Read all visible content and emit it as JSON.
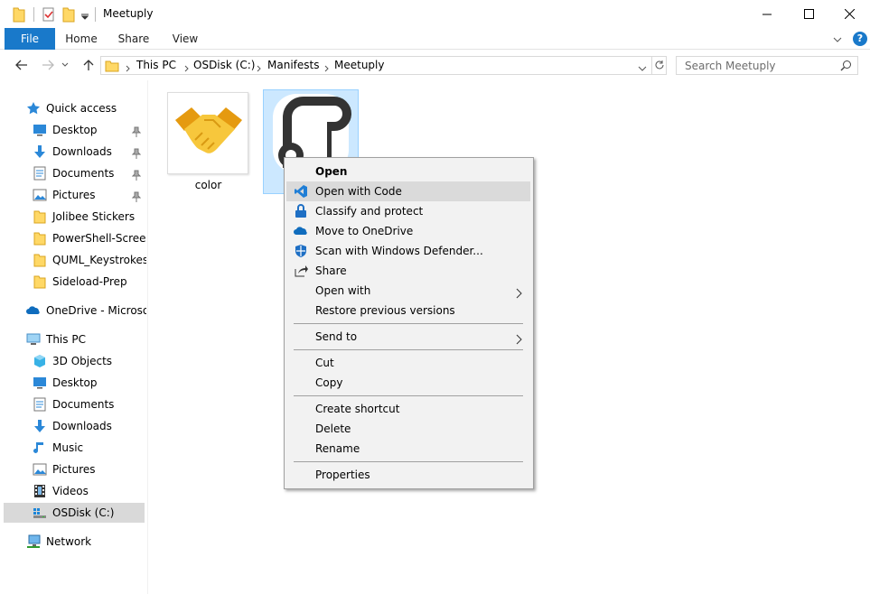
{
  "window": {
    "title": "Meetuply",
    "controls": [
      "minimize",
      "maximize",
      "close"
    ]
  },
  "ribbon": {
    "tabs": [
      {
        "label": "File",
        "active": true
      },
      {
        "label": "Home"
      },
      {
        "label": "Share"
      },
      {
        "label": "View"
      }
    ]
  },
  "address": {
    "crumbs": [
      "This PC",
      "OSDisk (C:)",
      "Manifests",
      "Meetuply"
    ]
  },
  "search": {
    "placeholder": "Search Meetuply"
  },
  "sidebar": {
    "quick_access": {
      "label": "Quick access",
      "items": [
        {
          "label": "Desktop",
          "icon": "desktop-icon",
          "pinned": true
        },
        {
          "label": "Downloads",
          "icon": "downloads-icon",
          "pinned": true
        },
        {
          "label": "Documents",
          "icon": "documents-icon",
          "pinned": true
        },
        {
          "label": "Pictures",
          "icon": "pictures-icon",
          "pinned": true
        },
        {
          "label": "Jolibee Stickers",
          "icon": "folder-icon"
        },
        {
          "label": "PowerShell-ScreenS",
          "icon": "folder-icon"
        },
        {
          "label": "QUML_Keystrokes",
          "icon": "folder-icon"
        },
        {
          "label": "Sideload-Prep",
          "icon": "folder-icon"
        }
      ]
    },
    "onedrive": {
      "label": "OneDrive - Microsoft"
    },
    "this_pc": {
      "label": "This PC",
      "items": [
        {
          "label": "3D Objects",
          "icon": "3d-objects-icon"
        },
        {
          "label": "Desktop",
          "icon": "desktop-icon"
        },
        {
          "label": "Documents",
          "icon": "documents-icon"
        },
        {
          "label": "Downloads",
          "icon": "downloads-icon"
        },
        {
          "label": "Music",
          "icon": "music-icon"
        },
        {
          "label": "Pictures",
          "icon": "pictures-icon"
        },
        {
          "label": "Videos",
          "icon": "videos-icon"
        },
        {
          "label": "OSDisk (C:)",
          "icon": "drive-icon",
          "selected": true
        }
      ]
    },
    "network": {
      "label": "Network"
    }
  },
  "files": [
    {
      "label": "color",
      "icon": "handshake-icon"
    },
    {
      "label": "",
      "icon": "outline-logo-icon",
      "selected": true
    }
  ],
  "context_menu": {
    "items": [
      {
        "label": "Open",
        "bold": true
      },
      {
        "label": "Open with Code",
        "icon": "vscode-icon",
        "hover": true
      },
      {
        "label": "Classify and protect",
        "icon": "classify-icon"
      },
      {
        "label": "Move to OneDrive",
        "icon": "onedrive-icon"
      },
      {
        "label": "Scan with Windows Defender...",
        "icon": "defender-icon"
      },
      {
        "label": "Share",
        "icon": "share-icon"
      },
      {
        "label": "Open with",
        "submenu": true
      },
      {
        "label": "Restore previous versions"
      },
      {
        "label": "Send to",
        "submenu": true
      },
      {
        "label": "Cut"
      },
      {
        "label": "Copy"
      },
      {
        "label": "Create shortcut"
      },
      {
        "label": "Delete"
      },
      {
        "label": "Rename"
      },
      {
        "label": "Properties"
      }
    ]
  },
  "colors": {
    "accent": "#1979ca",
    "folder": "#ffd866",
    "menu_bg": "#f2f2f2",
    "selection": "#cce8ff"
  }
}
